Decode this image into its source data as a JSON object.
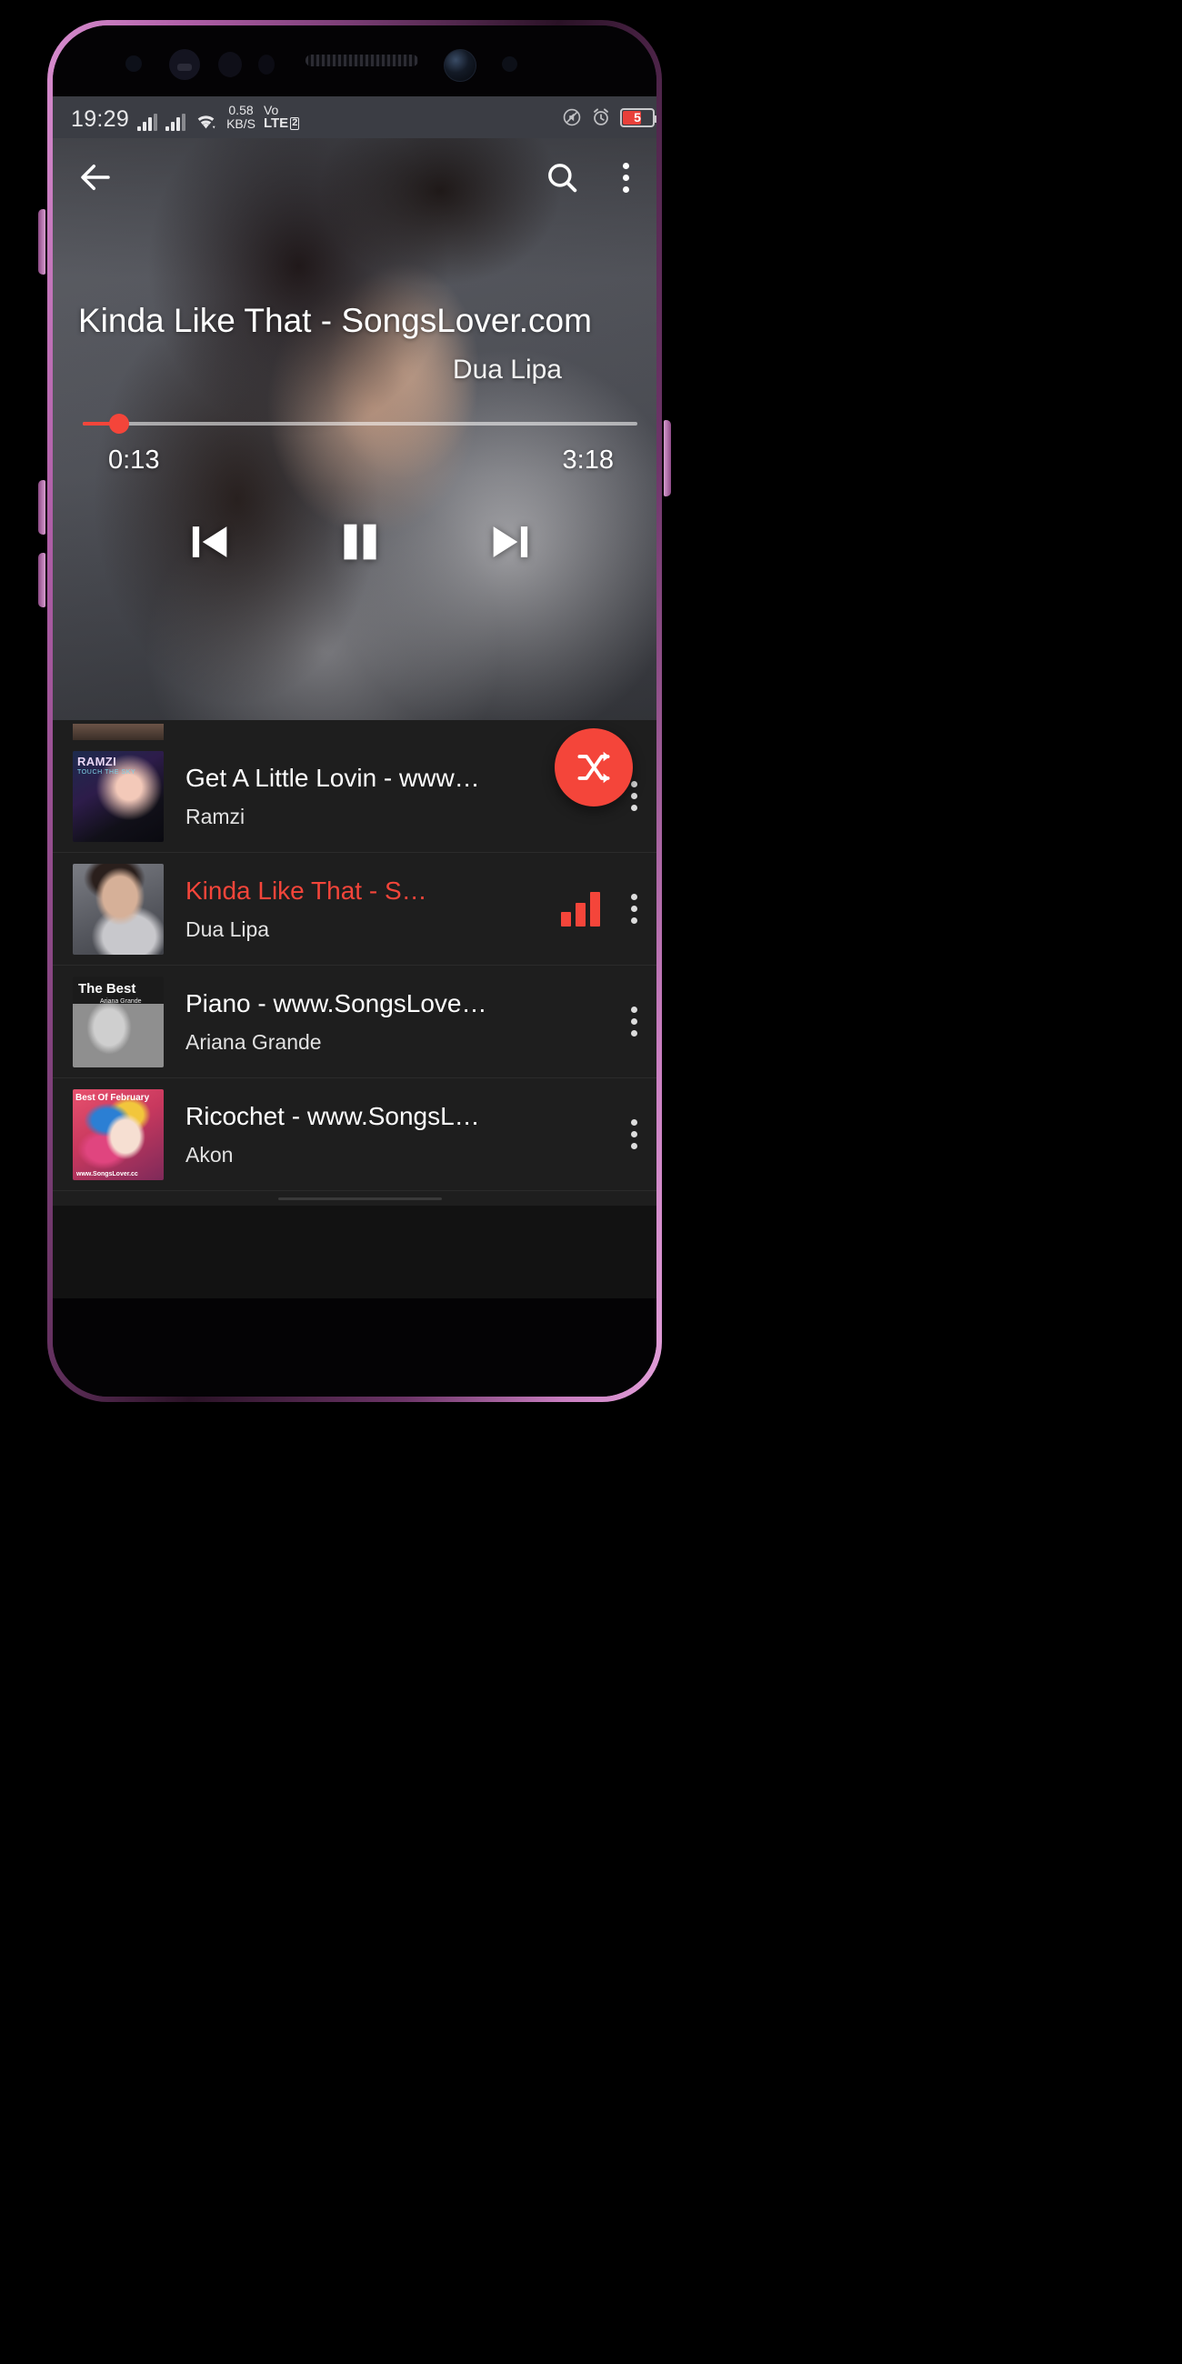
{
  "status_bar": {
    "clock": "19:29",
    "network_speed_value": "0.58",
    "network_speed_unit": "KB/S",
    "volte_label": "Vo",
    "lte_label": "LTE",
    "sim_number": "2",
    "battery_level": "5",
    "icons": [
      "signal-bars-sim1",
      "signal-bars-sim2",
      "wifi-icon",
      "mute-icon",
      "alarm-icon",
      "battery-icon"
    ],
    "accent_red": "#f4453a",
    "bar_bg": "#3b3d44"
  },
  "player": {
    "back_icon": "back-arrow-icon",
    "search_icon": "search-icon",
    "overflow_icon": "overflow-menu-icon",
    "title": "Kinda Like That - SongsLover.com",
    "artist": "Dua Lipa",
    "current_time": "0:13",
    "total_time": "3:18",
    "progress_percent": 6.5,
    "controls": {
      "previous": "previous-track-icon",
      "play_pause": "pause-icon",
      "next": "next-track-icon"
    }
  },
  "fab": {
    "icon": "shuffle-icon",
    "color": "#f4453a"
  },
  "playlist": {
    "tracks": [
      {
        "title": "Get A Little Lovin - www…",
        "artist": "Ramzi",
        "art": "art-ramzi",
        "active": false,
        "playing": false,
        "menu_icon": "overflow-menu-icon"
      },
      {
        "title": "Kinda Like That - S…",
        "artist": "Dua Lipa",
        "art": "art-dua",
        "active": true,
        "playing": true,
        "menu_icon": "overflow-menu-icon"
      },
      {
        "title": "Piano - www.SongsLove…",
        "artist": "Ariana Grande",
        "art": "art-ariana",
        "active": false,
        "playing": false,
        "menu_icon": "overflow-menu-icon"
      },
      {
        "title": "Ricochet - www.SongsL…",
        "artist": "Akon",
        "art": "art-akon",
        "active": false,
        "playing": false,
        "menu_icon": "overflow-menu-icon"
      }
    ]
  }
}
